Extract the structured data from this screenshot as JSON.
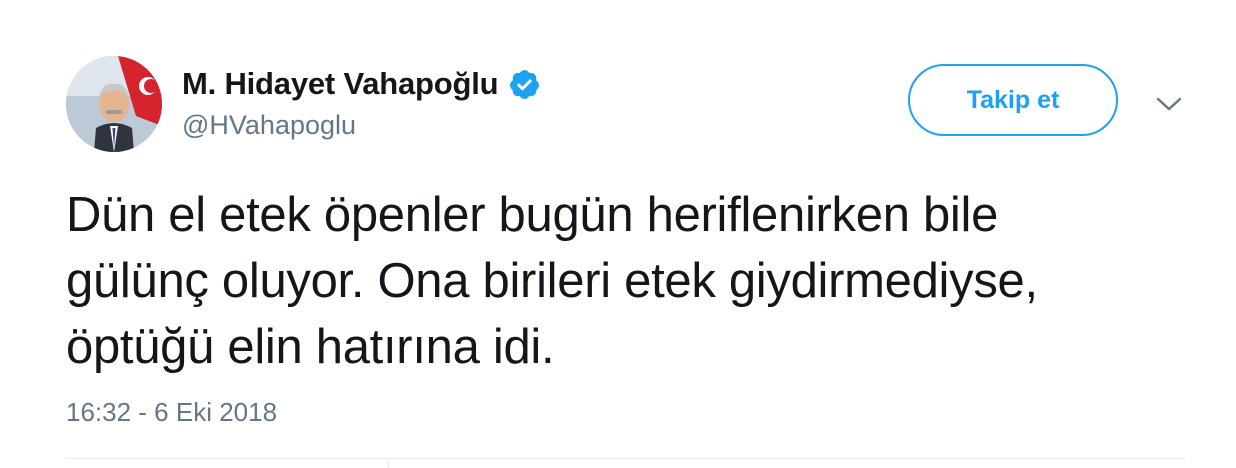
{
  "user": {
    "display_name": "M. Hidayet Vahapoğlu",
    "handle": "@HVahapoglu",
    "verified": true,
    "avatar_icon": "profile-photo"
  },
  "actions": {
    "follow_label": "Takip et",
    "more_icon": "chevron-down-icon"
  },
  "tweet": {
    "text": "Dün el etek öpenler bugün heriflenirken bile\ngülünç oluyor. Ona birileri etek giydirmediyse,\nöptüğü elin hatırına idi.",
    "timestamp": "16:32 - 6 Eki 2018"
  },
  "colors": {
    "accent": "#1da1f2",
    "text": "#14171a",
    "secondary": "#657786",
    "divider": "#e6ecf0"
  }
}
